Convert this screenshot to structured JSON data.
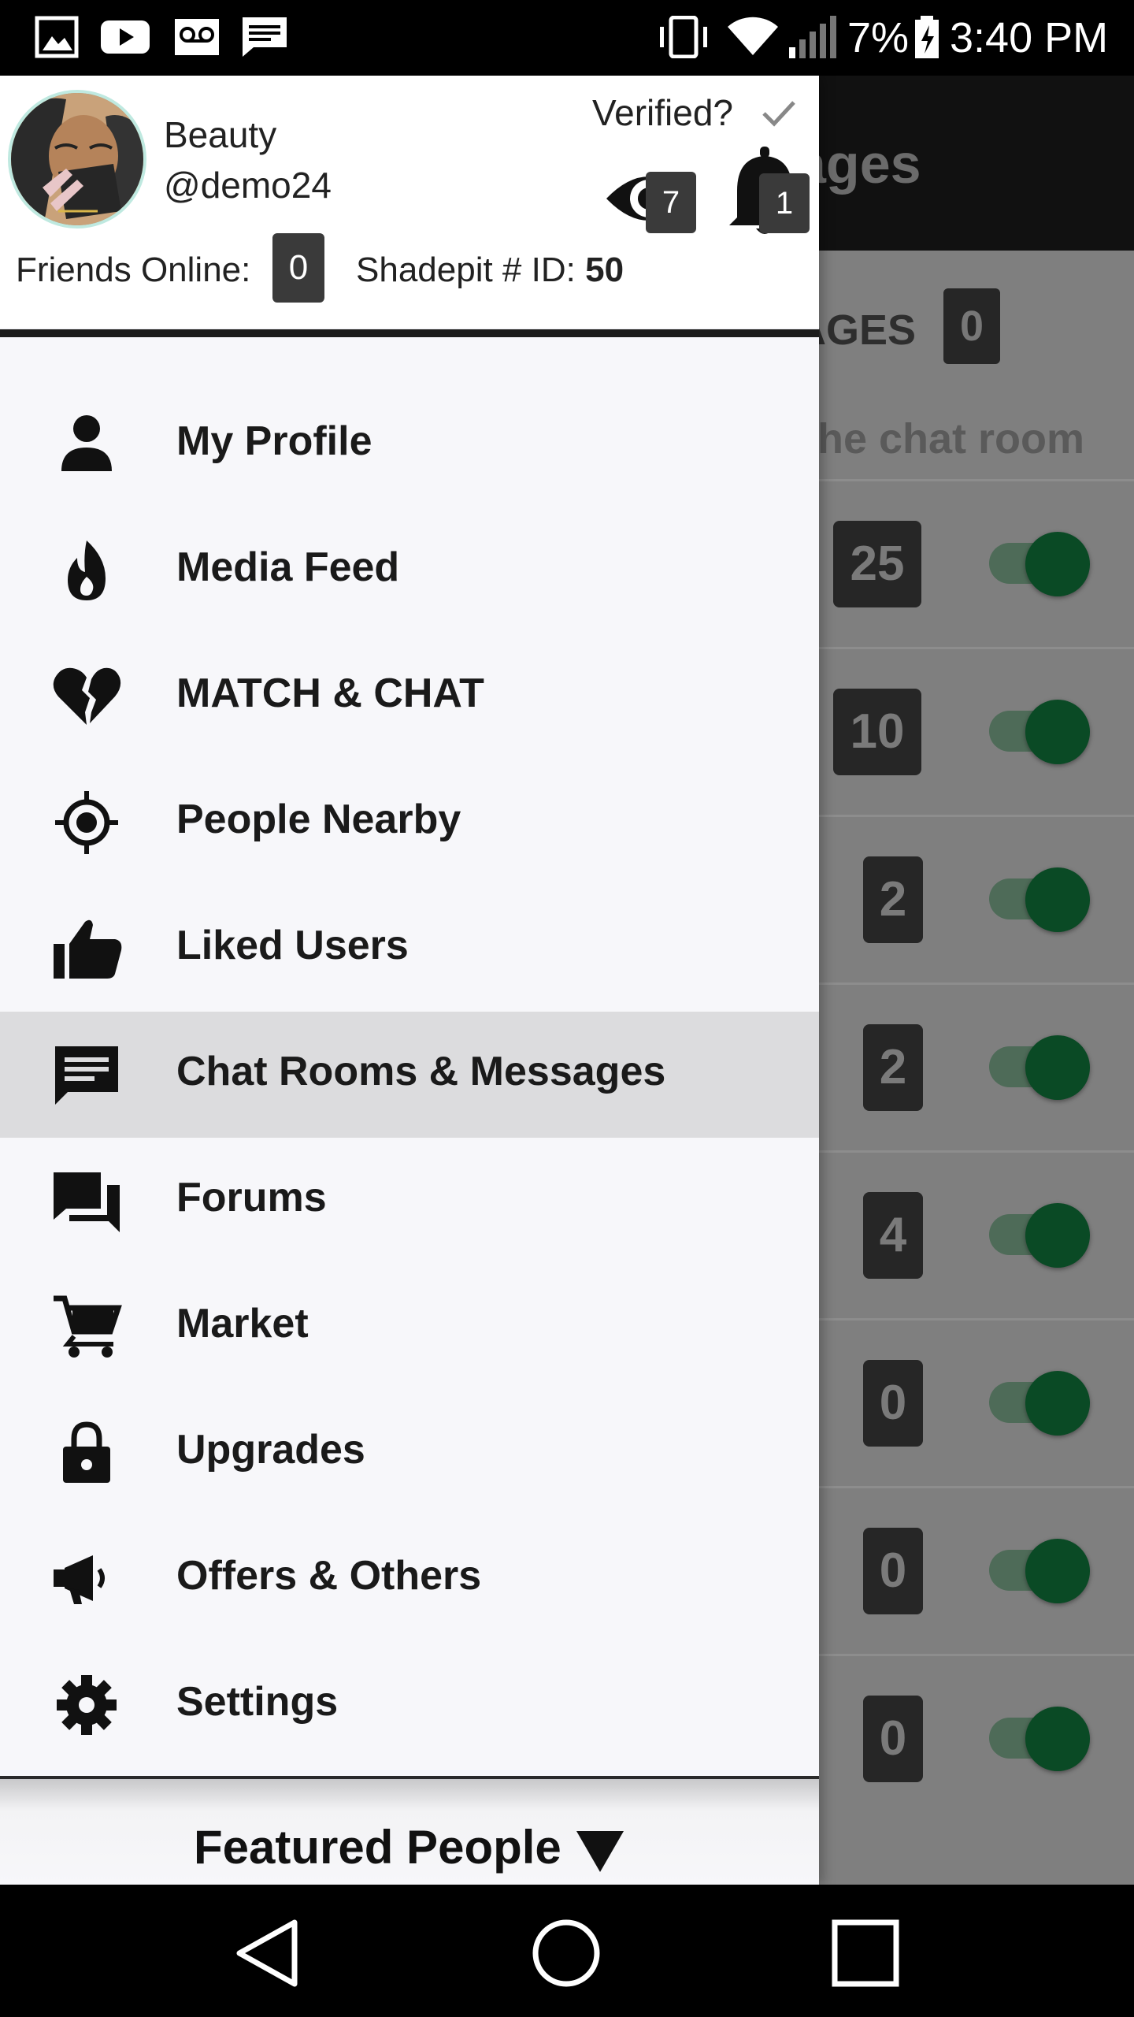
{
  "status_bar": {
    "battery": "7%",
    "time": "3:40 PM",
    "left_icons": [
      "gallery-icon",
      "youtube-icon",
      "voicemail-icon",
      "message-icon"
    ],
    "right_icons": [
      "vibrate-icon",
      "wifi-icon",
      "signal-icon",
      "battery-charging-icon"
    ]
  },
  "background_screen": {
    "title": "ages",
    "section_title": "AGES",
    "section_count": "0",
    "subtitle": "the chat room",
    "rows": [
      {
        "count": "25",
        "toggle_on": true
      },
      {
        "count": "10",
        "toggle_on": true
      },
      {
        "count": "2",
        "toggle_on": true
      },
      {
        "count": "2",
        "toggle_on": true
      },
      {
        "count": "4",
        "toggle_on": true
      },
      {
        "count": "0",
        "toggle_on": true
      },
      {
        "count": "0",
        "toggle_on": true
      },
      {
        "count": "0",
        "toggle_on": true
      }
    ]
  },
  "drawer": {
    "profile": {
      "display_name": "Beauty",
      "username": "@demo24",
      "verified_label": "Verified?",
      "views_count": "7",
      "notifications_count": "1",
      "friends_online_label": "Friends Online:",
      "friends_online_count": "0",
      "shadepit_label": "Shadepit # ID:",
      "shadepit_id": "50"
    },
    "menu": [
      {
        "label": "My Profile",
        "icon": "person-icon"
      },
      {
        "label": "Media Feed",
        "icon": "flame-icon"
      },
      {
        "label": "MATCH & CHAT",
        "icon": "broken-heart-icon"
      },
      {
        "label": "People Nearby",
        "icon": "location-target-icon"
      },
      {
        "label": "Liked Users",
        "icon": "thumbs-up-icon"
      },
      {
        "label": "Chat Rooms & Messages",
        "icon": "chat-bubble-icon",
        "active": true
      },
      {
        "label": "Forums",
        "icon": "forum-icon"
      },
      {
        "label": "Market",
        "icon": "cart-icon"
      },
      {
        "label": "Upgrades",
        "icon": "lock-icon"
      },
      {
        "label": "Offers & Others",
        "icon": "megaphone-icon"
      },
      {
        "label": "Settings",
        "icon": "gear-icon"
      }
    ],
    "featured_label": "Featured People"
  },
  "nav_bar": {
    "buttons": [
      "back-icon",
      "home-icon",
      "recents-icon"
    ]
  },
  "colors": {
    "drawer_bg": "#f7f7fa",
    "active_item_bg": "#dcdcde",
    "toggle_knob": "#0a4a25",
    "badge_bg": "#3a3a3a"
  }
}
